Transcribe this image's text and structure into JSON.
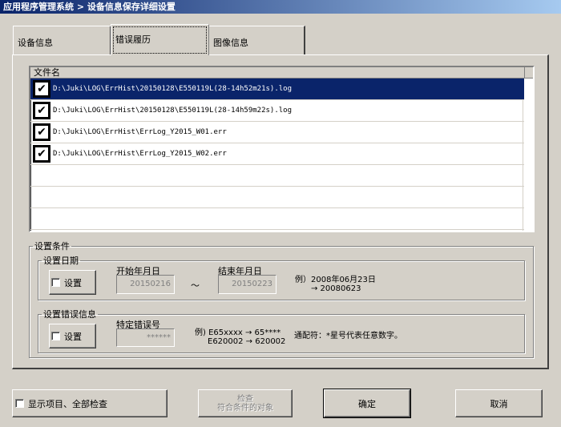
{
  "window": {
    "title": "应用程序管理系统 > 设备信息保存详细设置"
  },
  "tabs": [
    {
      "label": "设备信息",
      "selected": false
    },
    {
      "label": "错误履历",
      "selected": true
    },
    {
      "label": "图像信息",
      "selected": false
    }
  ],
  "file_list": {
    "header": "文件名",
    "rows": [
      {
        "path": "D:\\Juki\\LOG\\ErrHist\\20150128\\E550119L(28-14h52m21s).log",
        "checked": true,
        "selected": true
      },
      {
        "path": "D:\\Juki\\LOG\\ErrHist\\20150128\\E550119L(28-14h59m22s).log",
        "checked": true,
        "selected": false
      },
      {
        "path": "D:\\Juki\\LOG\\ErrHist\\ErrLog_Y2015_W01.err",
        "checked": true,
        "selected": false
      },
      {
        "path": "D:\\Juki\\LOG\\ErrHist\\ErrLog_Y2015_W02.err",
        "checked": true,
        "selected": false
      }
    ]
  },
  "conditions": {
    "title": "设置条件",
    "date": {
      "title": "设置日期",
      "set_label": "设置",
      "start_label": "开始年月日",
      "start_value": "20150216",
      "sep": "～",
      "end_label": "结束年月日",
      "end_value": "20150223",
      "example_line1": "例）2008年06月23日",
      "example_line2": "→ 20080623"
    },
    "error": {
      "title": "设置错误信息",
      "set_label": "设置",
      "code_label": "特定错误号",
      "code_value": "******",
      "example_line1": "例) E65xxxx → 65****",
      "example_line2": "E620002 → 620002",
      "wildcard_note": "通配符：*星号代表任意数字。"
    }
  },
  "footer": {
    "show_all_label": "显示项目、全部检查",
    "search_line1": "检查",
    "search_line2": "符合条件的对象",
    "ok_label": "确定",
    "cancel_label": "取消"
  }
}
